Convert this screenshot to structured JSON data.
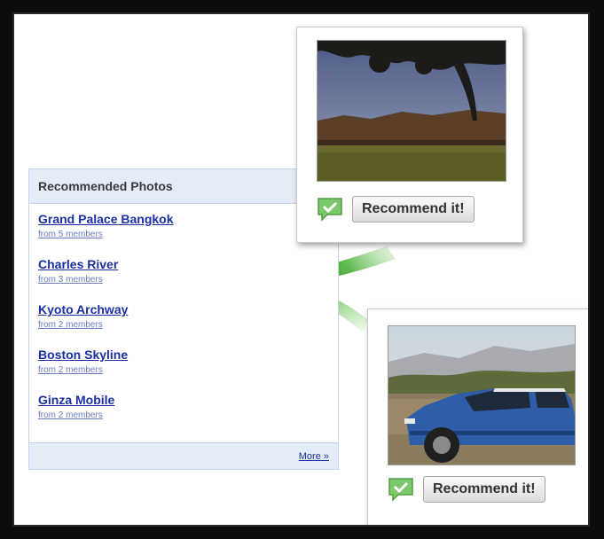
{
  "widget": {
    "title": "Recommended Photos",
    "items": [
      {
        "title": "Grand Palace Bangkok",
        "meta": "from 5 members"
      },
      {
        "title": "Charles River",
        "meta": "from 3 members"
      },
      {
        "title": "Kyoto Archway",
        "meta": "from 2 members"
      },
      {
        "title": "Boston Skyline",
        "meta": "from 2 members"
      },
      {
        "title": "Ginza Mobile",
        "meta": "from 2 members"
      }
    ],
    "more_label": "More »"
  },
  "cards": [
    {
      "button_label": "Recommend it!",
      "icon": "checkmark-speech-bubble-icon"
    },
    {
      "button_label": "Recommend it!",
      "icon": "checkmark-speech-bubble-icon"
    }
  ],
  "colors": {
    "header_bg": "#e4ecf8",
    "link": "#1b2fa3",
    "arrow_green": "#3a9a2a",
    "icon_green": "#7bc96a"
  }
}
